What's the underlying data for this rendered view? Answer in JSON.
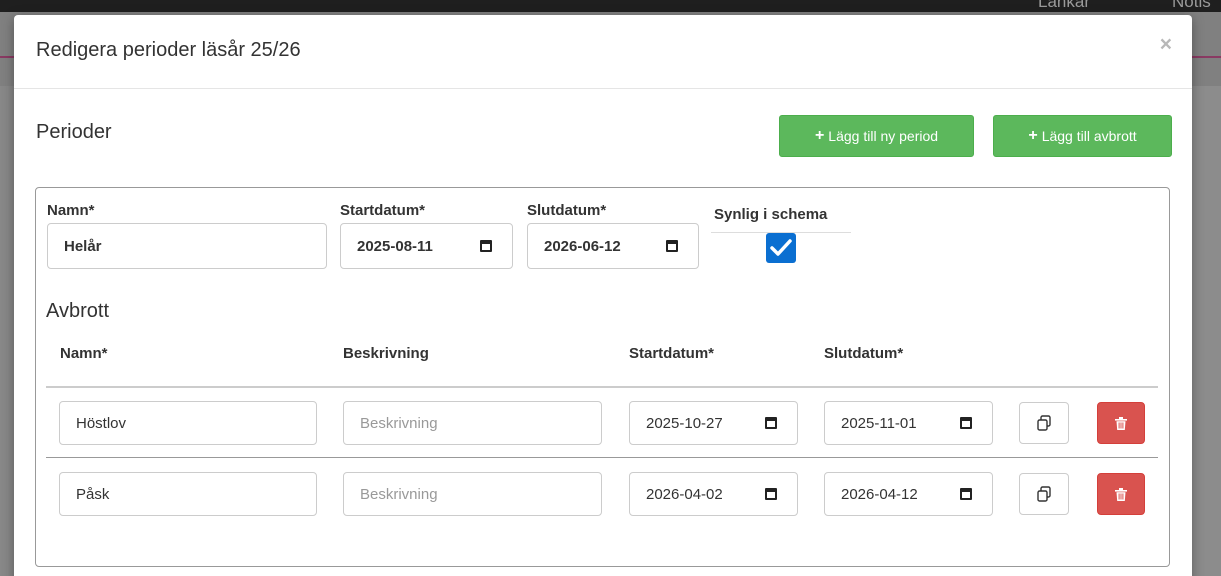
{
  "background": {
    "top_right_text_1": "Länkar",
    "top_right_text_2": "Notis"
  },
  "modal": {
    "title": "Redigera perioder läsår 25/26",
    "close_label": "×"
  },
  "periods_section": {
    "title": "Perioder",
    "add_period_label": "Lägg till ny period",
    "add_break_label": "Lägg till avbrott"
  },
  "period": {
    "name_label": "Namn*",
    "name_value": "Helår",
    "start_label": "Startdatum*",
    "start_value": "2025-08-11",
    "end_label": "Slutdatum*",
    "end_value": "2026-06-12",
    "visible_label": "Synlig i schema",
    "visible_checked": true
  },
  "breaks": {
    "title": "Avbrott",
    "columns": {
      "name": "Namn*",
      "description": "Beskrivning",
      "start": "Startdatum*",
      "end": "Slutdatum*"
    },
    "description_placeholder": "Beskrivning",
    "rows": [
      {
        "name": "Höstlov",
        "description": "",
        "start": "2025-10-27",
        "end": "2025-11-01"
      },
      {
        "name": "Påsk",
        "description": "",
        "start": "2026-04-02",
        "end": "2026-04-12"
      }
    ]
  },
  "colors": {
    "green": "#5cb85c",
    "danger": "#d9534f",
    "checkbox": "#0b6fd1"
  }
}
